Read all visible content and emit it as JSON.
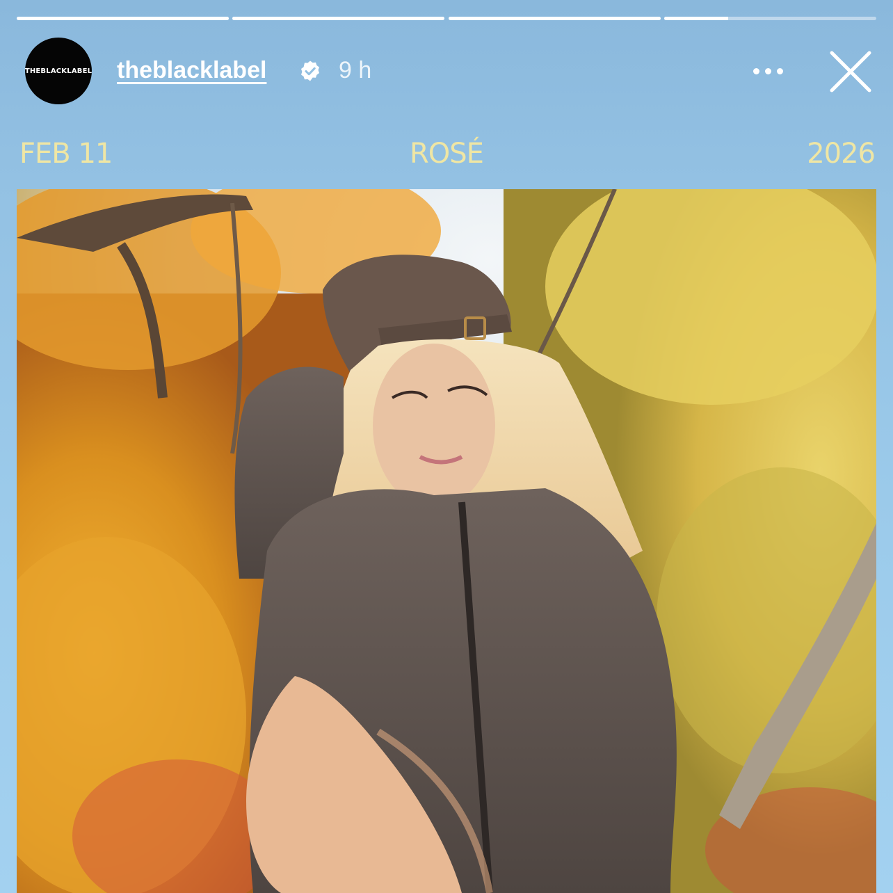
{
  "story": {
    "progress": [
      1,
      1,
      1,
      0.3
    ]
  },
  "account": {
    "avatar_text": "THEBLACKLABEL",
    "username": "theblacklabel",
    "verified": true,
    "time": "9 h"
  },
  "post": {
    "date": "FEB 11",
    "name": "ROSÉ",
    "year": "2026"
  },
  "icons": {
    "verified": "verified-badge-icon",
    "more": "more-options-icon",
    "close": "close-icon"
  },
  "colors": {
    "background": "#95c4e6",
    "caption": "#efe6a4"
  }
}
